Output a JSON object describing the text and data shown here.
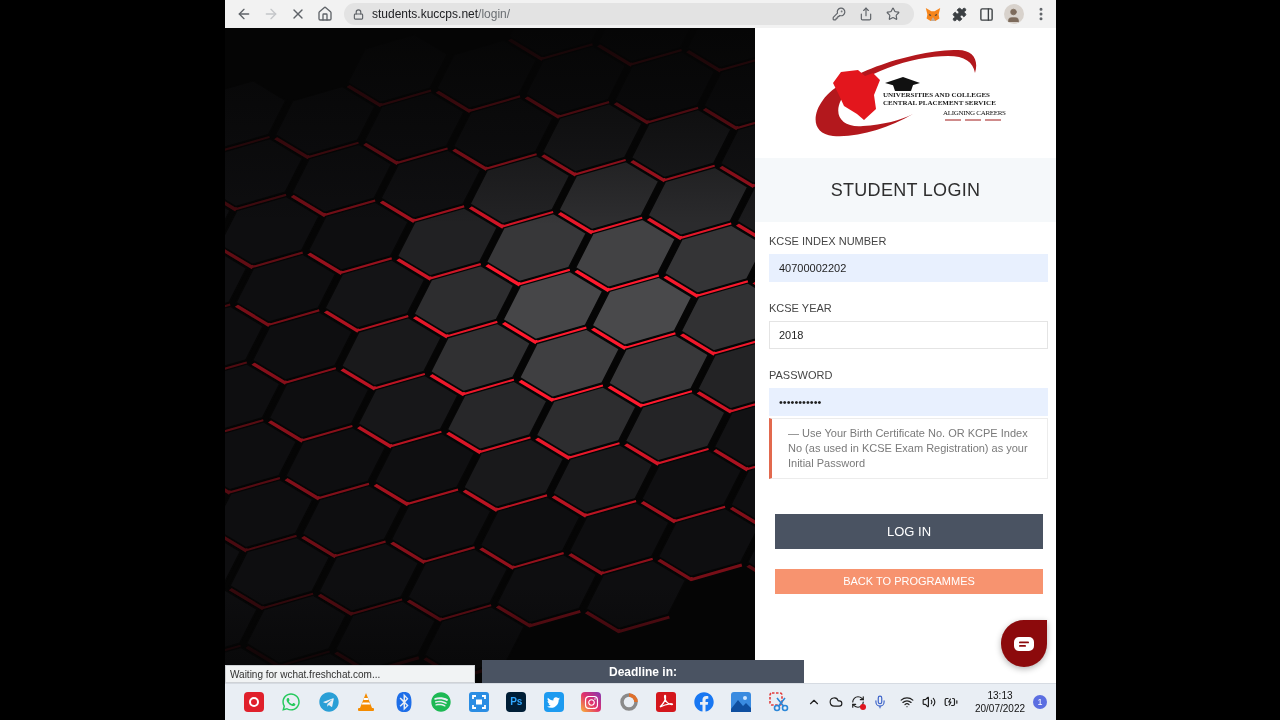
{
  "browser": {
    "url_host": "students.kuccps.net",
    "url_path": "/login/",
    "loading": true
  },
  "logo": {
    "tagline": "UNIVERSITIES AND COLLEGES CENTRAL PLACEMENT SERVICE",
    "motto": "ALIGNING CAREERS"
  },
  "login": {
    "title": "STUDENT LOGIN",
    "fields": [
      {
        "label": "KCSE INDEX NUMBER",
        "value": "40700002202",
        "autofilled": true
      },
      {
        "label": "KCSE YEAR",
        "value": "2018",
        "autofilled": false
      },
      {
        "label": "PASSWORD",
        "value": "•••••••••••",
        "autofilled": true
      }
    ],
    "hint": "— Use Your Birth Certificate No. OR KCPE Index No (as used in KCSE Exam Registration) as your Initial Password",
    "buttons": [
      {
        "label": "LOG IN",
        "kind": "primary"
      },
      {
        "label": "BACK TO PROGRAMMES",
        "kind": "secondary"
      }
    ]
  },
  "status_bubble": "Waiting for wchat.freshchat.com...",
  "deadline_bar": {
    "label": "Deadline in:"
  },
  "taskbar": {
    "photo_app_label": "Ps",
    "time": "13:13",
    "date": "20/07/2022",
    "notifications": "1"
  }
}
